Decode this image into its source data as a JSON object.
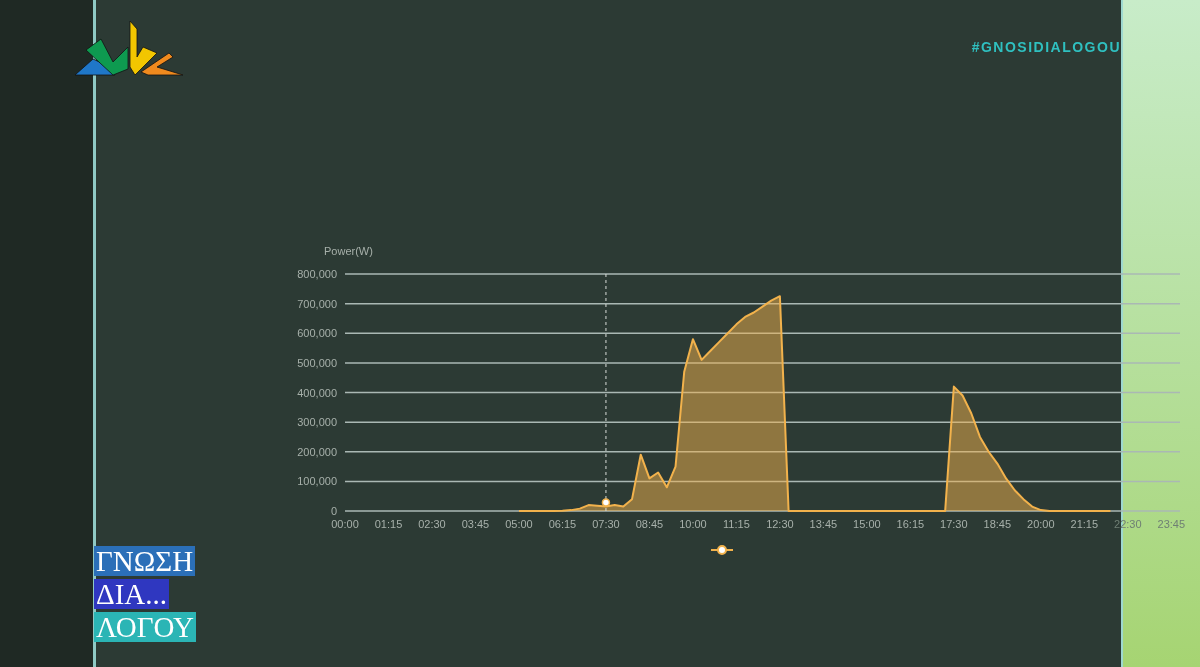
{
  "hashtag": "#GNOSIDIALOGOU",
  "title_blocks": [
    {
      "text": "ΓΝΩΣΗ",
      "color": "#2b6fb8"
    },
    {
      "text": "ΔΙΑ...",
      "color": "#2f37c0"
    },
    {
      "text": "ΛΟΓΟΥ",
      "color": "#2bb5b5"
    }
  ],
  "chart": {
    "chart_data": {
      "type": "area",
      "ylabel": "Power(W)",
      "grid": true,
      "x": [
        5,
        5.25,
        5.5,
        5.75,
        6,
        6.25,
        6.5,
        6.75,
        7,
        7.25,
        7.5,
        7.75,
        8,
        8.25,
        8.5,
        8.75,
        9,
        9.25,
        9.5,
        9.75,
        10,
        10.25,
        10.5,
        10.75,
        11,
        11.25,
        11.5,
        11.75,
        12,
        12.25,
        12.5,
        12.75,
        13,
        13.25,
        13.5,
        13.75,
        14,
        14.25,
        14.5,
        14.75,
        15,
        15.25,
        15.5,
        15.75,
        16,
        16.25,
        16.5,
        16.75,
        17,
        17.25,
        17.5,
        17.75,
        18,
        18.25,
        18.5,
        18.75,
        19,
        19.25,
        19.5,
        19.75,
        20,
        20.25,
        20.5,
        20.75,
        21,
        21.25,
        21.5,
        21.75,
        22
      ],
      "series": [
        {
          "color": "#f2b24c",
          "values": [
            0,
            0,
            0,
            0,
            0,
            1000,
            3000,
            8000,
            20000,
            18000,
            15000,
            20000,
            15000,
            40000,
            190000,
            110000,
            130000,
            80000,
            150000,
            470000,
            580000,
            510000,
            540000,
            570000,
            600000,
            630000,
            655000,
            670000,
            690000,
            710000,
            725000,
            0,
            0,
            0,
            0,
            0,
            0,
            0,
            0,
            0,
            0,
            0,
            0,
            0,
            0,
            0,
            0,
            0,
            0,
            0,
            420000,
            390000,
            330000,
            250000,
            200000,
            160000,
            110000,
            70000,
            40000,
            15000,
            3000,
            0,
            0,
            0,
            0,
            0,
            0,
            0,
            0
          ]
        }
      ],
      "xlim": [
        0,
        24
      ],
      "ylim": [
        0,
        800000
      ],
      "xticks": [
        {
          "value": 0,
          "label": "00:00"
        },
        {
          "value": 1.25,
          "label": "01:15"
        },
        {
          "value": 2.5,
          "label": "02:30"
        },
        {
          "value": 3.75,
          "label": "03:45"
        },
        {
          "value": 5,
          "label": "05:00"
        },
        {
          "value": 6.25,
          "label": "06:15"
        },
        {
          "value": 7.5,
          "label": "07:30"
        },
        {
          "value": 8.75,
          "label": "08:45"
        },
        {
          "value": 10,
          "label": "10:00"
        },
        {
          "value": 11.25,
          "label": "11:15"
        },
        {
          "value": 12.5,
          "label": "12:30"
        },
        {
          "value": 13.75,
          "label": "13:45"
        },
        {
          "value": 15,
          "label": "15:00"
        },
        {
          "value": 16.25,
          "label": "16:15"
        },
        {
          "value": 17.5,
          "label": "17:30"
        },
        {
          "value": 18.75,
          "label": "18:45"
        },
        {
          "value": 20,
          "label": "20:00"
        },
        {
          "value": 21.25,
          "label": "21:15"
        },
        {
          "value": 22.5,
          "label": "22:30"
        },
        {
          "value": 23.75,
          "label": "23:45"
        }
      ],
      "yticks": [
        {
          "value": 0,
          "label": "0"
        },
        {
          "value": 100000,
          "label": "100,000"
        },
        {
          "value": 200000,
          "label": "200,000"
        },
        {
          "value": 300000,
          "label": "300,000"
        },
        {
          "value": 400000,
          "label": "400,000"
        },
        {
          "value": 500000,
          "label": "500,000"
        },
        {
          "value": 600000,
          "label": "600,000"
        },
        {
          "value": 700000,
          "label": "700,000"
        },
        {
          "value": 800000,
          "label": "800,000"
        }
      ],
      "ref_lines": [
        {
          "axis": "x",
          "value": 7.5
        }
      ]
    }
  }
}
